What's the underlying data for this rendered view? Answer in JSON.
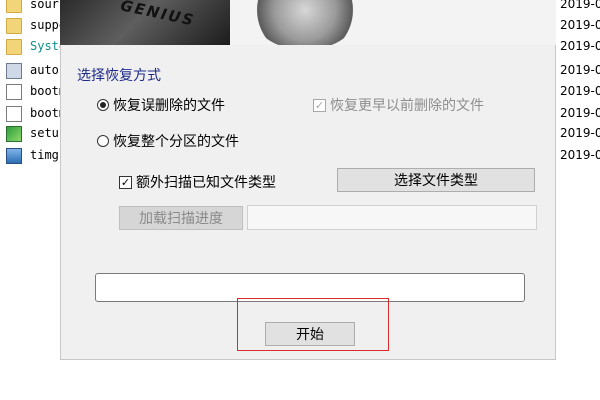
{
  "files": [
    {
      "name": "sources",
      "date": "2019-0",
      "icon": "folder-icon",
      "style": "folder"
    },
    {
      "name": "support",
      "date": "2019-0",
      "icon": "folder-icon",
      "style": "folder"
    },
    {
      "name": "System",
      "date": "2019-0",
      "icon": "folder-icon",
      "style": "folder"
    },
    {
      "name": "autorun",
      "date": "2019-0",
      "icon": "autorun-icon",
      "style": "exe"
    },
    {
      "name": "bootmgr",
      "date": "2019-0",
      "icon": "document-icon",
      "style": "doc"
    },
    {
      "name": "bootmgr",
      "date": "2019-0",
      "icon": "document-icon",
      "style": "doc"
    },
    {
      "name": "setup",
      "date": "2019-0",
      "icon": "setup-icon",
      "style": "setup-ic"
    },
    {
      "name": "timg.",
      "date": "2019-0",
      "icon": "image-icon",
      "style": "img-ic"
    }
  ],
  "banner": {
    "text": "GENIUS"
  },
  "dialog": {
    "section_title": "选择恢复方式",
    "option_deleted": "恢复误删除的文件",
    "option_earlier": "恢复更早以前删除的文件",
    "option_partition": "恢复整个分区的文件",
    "extra_scan_label": "额外扫描已知文件类型",
    "select_types_button": "选择文件类型",
    "load_progress_button": "加载扫描进度",
    "start_button": "开始"
  },
  "colors": {
    "highlight": "#d92b2b",
    "section_title": "#1e2a8a"
  }
}
